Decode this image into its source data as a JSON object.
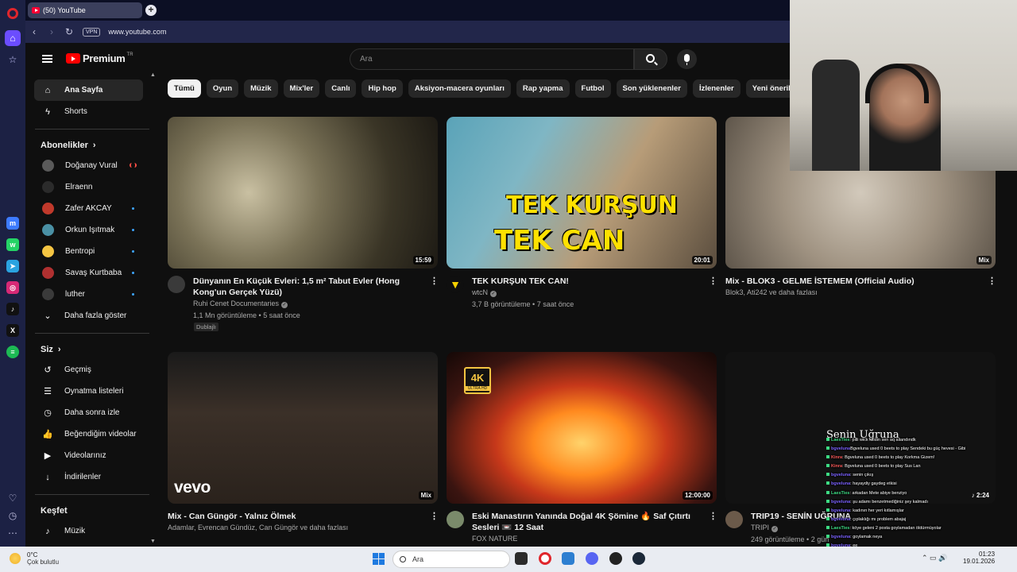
{
  "browser": {
    "tab_title": "(50) YouTube",
    "url": "www.youtube.com",
    "vpn_label": "VPN"
  },
  "header": {
    "logo_text": "Premium",
    "logo_country": "TR",
    "search_placeholder": "Ara"
  },
  "guide": {
    "home": "Ana Sayfa",
    "shorts": "Shorts",
    "subscriptions_title": "Abonelikler",
    "subscriptions": [
      {
        "name": "Doğanay Vural",
        "color": "#5a5a5a",
        "status": "live"
      },
      {
        "name": "Elraenn",
        "color": "#2b2b2b",
        "status": ""
      },
      {
        "name": "Zafer AKCAY",
        "color": "#c0392b",
        "status": "new"
      },
      {
        "name": "Orkun Işıtmak",
        "color": "#4a90a4",
        "status": "new"
      },
      {
        "name": "Bentropi",
        "color": "#f5c542",
        "status": "new"
      },
      {
        "name": "Savaş Kurtbaba",
        "color": "#b03030",
        "status": "new"
      },
      {
        "name": "luther",
        "color": "#3a3a3a",
        "status": "new"
      }
    ],
    "show_more": "Daha fazla göster",
    "you_title": "Siz",
    "you_items": [
      {
        "label": "Geçmiş",
        "icon": "history-icon",
        "glyph": "↺"
      },
      {
        "label": "Oynatma listeleri",
        "icon": "playlists-icon",
        "glyph": "☰"
      },
      {
        "label": "Daha sonra izle",
        "icon": "watch-later-icon",
        "glyph": "◷"
      },
      {
        "label": "Beğendiğim videolar",
        "icon": "like-icon",
        "glyph": "👍"
      },
      {
        "label": "Videolarınız",
        "icon": "your-videos-icon",
        "glyph": "▶"
      },
      {
        "label": "İndirilenler",
        "icon": "download-icon",
        "glyph": "↓"
      }
    ],
    "explore_title": "Keşfet",
    "explore_items": [
      {
        "label": "Müzik",
        "icon": "music-icon",
        "glyph": "♪"
      }
    ]
  },
  "chips": [
    "Tümü",
    "Oyun",
    "Müzik",
    "Mix'ler",
    "Canlı",
    "Hip hop",
    "Aksiyon-macera oyunları",
    "Rap yapma",
    "Futbol",
    "Son yüklenenler",
    "İzlenenler",
    "Yeni öneriler"
  ],
  "videos": [
    {
      "title": "Dünyanın En Küçük Evleri: 1,5 m² Tabut Evler (Hong Kong'un Gerçek Yüzü)",
      "channel": "Ruhi Cenet Documentaries",
      "stats": "1,1 Mn görüntüleme • 5 saat önce",
      "badge": "Dublajlı",
      "duration": "15:59"
    },
    {
      "title": "TEK KURŞUN TEK CAN!",
      "channel": "wtcN",
      "stats": "3,7 B görüntüleme • 7 saat önce",
      "duration": "20:01",
      "thumb_text_1": "TEK KURŞUN",
      "thumb_text_2": "TEK CAN"
    },
    {
      "title": "Mix - BLOK3 - GELME İSTEMEM (Official Audio)",
      "channel": "Blok3, Ati242 ve daha fazlası",
      "mix_label": "Mix"
    },
    {
      "title": "Mix - Can Güngör - Yalnız Ölmek",
      "channel": "Adamlar, Evrencan Gündüz, Can Güngör ve daha fazlası",
      "mix_label": "Mix",
      "vevo": "vevo"
    },
    {
      "title": "Eski Manastırın Yanında Doğal 4K Şömine 🔥 Saf Çıtırtı Sesleri 📼 12 Saat",
      "channel": "FOX NATURE",
      "duration": "12:00:00",
      "fourk_big": "4K",
      "fourk_small": "ULTRA HD"
    },
    {
      "title": "TRIP19 - SENİN UĞRUNA",
      "channel": "TRIPI",
      "stats": "249 görüntüleme • 2 gün",
      "duration": "2:24"
    }
  ],
  "chat": {
    "title": "Senin Uğruna",
    "lines": [
      {
        "user": "LaesTies",
        "cls": "g",
        "text": ": pilli wick kilidin sen aq aliandındk"
      },
      {
        "user": "bgveluna",
        "cls": "",
        "text": "Bgveluna used 0 beets to play Sendeki bu güç hevesi - Gibi"
      },
      {
        "user": "Kinra",
        "cls": "r",
        "text": ": Bgveluna used 0 beets to play Korkma Gizem!"
      },
      {
        "user": "Kinra",
        "cls": "r",
        "text": ": Bgveluna used 0 beets to play Sus Lan"
      },
      {
        "user": "bgveluna",
        "cls": "",
        "text": ": senin çıkış"
      },
      {
        "user": "bgveluna",
        "cls": "",
        "text": ": hayaydiy gaydeg etkisi"
      },
      {
        "user": "LaesTies",
        "cls": "g",
        "text": ": arkadan Mete abiye benziyo"
      },
      {
        "user": "bgveluna",
        "cls": "",
        "text": ": şu adamı benzetmediğiniz şey kalmadı"
      },
      {
        "user": "bgveluna",
        "cls": "",
        "text": ": kadının her yeri kıtlamışlar"
      },
      {
        "user": "bgveluna",
        "cls": "",
        "text": ": çıplaklığı mı problem abajaj"
      },
      {
        "user": "LaesTies",
        "cls": "g",
        "text": ": köye geleni 2 posta goylamadan öldürmüyolar"
      },
      {
        "user": "bgveluna",
        "cls": "",
        "text": ": goylamak neya"
      },
      {
        "user": "bgveluna",
        "cls": "",
        "text": ": ee"
      },
      {
        "user": "bgveluna",
        "cls": "",
        "text": ": açıklayıcı bir anlatımı oldu"
      },
      {
        "user": "LaesTies",
        "cls": "g",
        "text": ": hikayesi sarmadı bunun ya"
      },
      {
        "user": "bgveluna",
        "cls": "",
        "text": ": ne ki hikayesi"
      }
    ]
  },
  "taskbar": {
    "temp": "0°C",
    "weather": "Çok bulutlu",
    "search": "Ara",
    "time": "01:23",
    "date": "19.01.2026"
  }
}
